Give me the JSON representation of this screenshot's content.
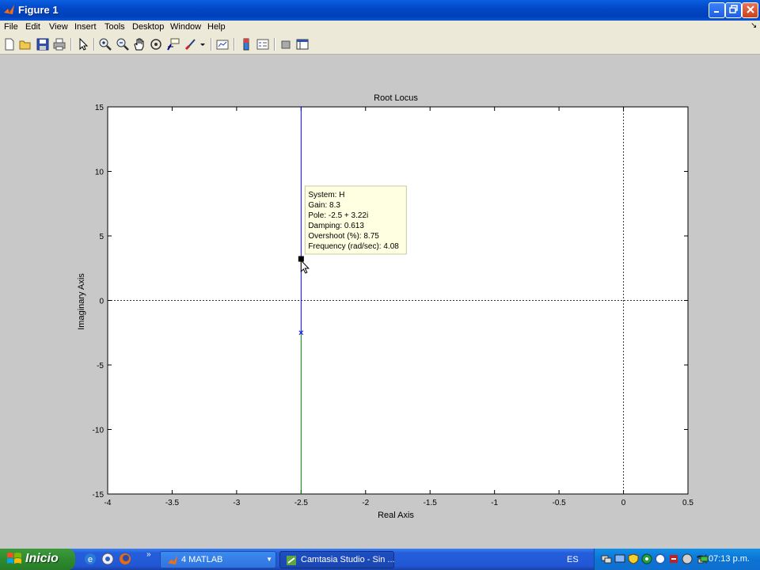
{
  "window": {
    "title": "Figure 1"
  },
  "menu": [
    "File",
    "Edit",
    "View",
    "Insert",
    "Tools",
    "Desktop",
    "Window",
    "Help"
  ],
  "toolbar_icons": [
    "new-file-icon",
    "open-folder-icon",
    "save-icon",
    "print-icon",
    "arrow-select-icon",
    "zoom-in-icon",
    "zoom-out-icon",
    "pan-hand-icon",
    "rotate-3d-icon",
    "data-cursor-icon",
    "brush-icon",
    "dropdown-arrow-icon",
    "link-plot-icon",
    "colorbar-icon",
    "legend-icon",
    "hide-plot-tools-icon",
    "show-plot-tools-icon"
  ],
  "chart_data": {
    "type": "line",
    "title": "Root Locus",
    "xlabel": "Real Axis",
    "ylabel": "Imaginary Axis",
    "xlim": [
      -4,
      0.5
    ],
    "ylim": [
      -15,
      15
    ],
    "xticks": [
      -4,
      -3.5,
      -3,
      -2.5,
      -2,
      -1.5,
      -1,
      -0.5,
      0,
      0.5
    ],
    "yticks": [
      -15,
      -10,
      -5,
      0,
      5,
      10,
      15
    ],
    "xtick_labels": [
      "-4",
      "-3.5",
      "-3",
      "-2.5",
      "-2",
      "-1.5",
      "-1",
      "-0.5",
      "0",
      "0.5"
    ],
    "ytick_labels": [
      "-15",
      "-10",
      "-5",
      "0",
      "5",
      "10",
      "15"
    ],
    "series": [
      {
        "color": "#0000ff",
        "x": [
          -2.5,
          -2.5
        ],
        "y": [
          -2.5,
          15
        ]
      },
      {
        "color": "#008000",
        "x": [
          -2.5,
          -2.5
        ],
        "y": [
          -2.5,
          -15
        ]
      }
    ],
    "poles": [
      {
        "x": -2.5,
        "y": -2.5,
        "marker": "x",
        "color": "#0000ff"
      }
    ],
    "datatip": {
      "x": -2.5,
      "y": 3.22,
      "lines": [
        "System: H",
        "Gain: 8.3",
        "Pole: -2.5 + 3.22i",
        "Damping: 0.613",
        "Overshoot (%): 8.75",
        "Frequency (rad/sec): 4.08"
      ]
    },
    "grid": false
  },
  "taskbar": {
    "start_label": "Inicio",
    "tasks": [
      {
        "label": "4 MATLAB",
        "icon": "matlab-icon"
      },
      {
        "label": "Camtasia Studio - Sin ...",
        "icon": "camtasia-icon"
      }
    ],
    "language": "ES",
    "time": "07:13 p.m."
  }
}
